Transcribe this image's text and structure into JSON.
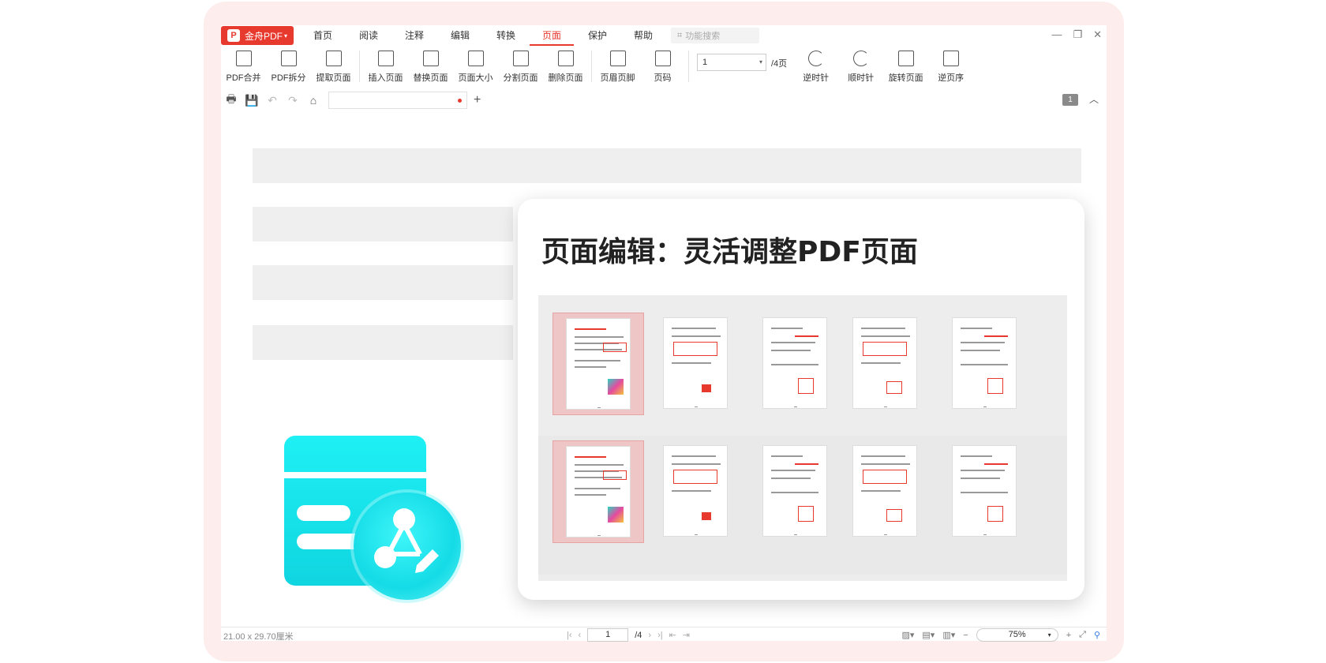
{
  "menubar": {
    "brand": "金舟PDF",
    "brand_logo": "P",
    "items": [
      "首页",
      "阅读",
      "注释",
      "编辑",
      "转换",
      "页面",
      "保护",
      "帮助"
    ],
    "active": "页面",
    "search_placeholder": "功能搜索"
  },
  "ribbon": {
    "group1": [
      "PDF合并",
      "PDF拆分",
      "提取页面"
    ],
    "group2": [
      "插入页面",
      "替换页面",
      "页面大小",
      "分割页面",
      "删除页面"
    ],
    "group3": [
      "页眉页脚",
      "页码"
    ],
    "page_value": "1",
    "page_total": "/4页",
    "group4": [
      "逆时针",
      "顺时针",
      "旋转页面",
      "逆页序"
    ]
  },
  "quickbar": {
    "page_badge": "1"
  },
  "feature": {
    "title": "页面编辑：灵活调整PDF页面"
  },
  "status": {
    "dimensions": "21.00 x 29.70厘米",
    "page_value": "1",
    "page_total": "/4",
    "zoom": "75%"
  },
  "colors": {
    "accent": "#e8392e",
    "icon_cyan": "#14dbe6",
    "selected_thumb": "#efc6c6"
  }
}
